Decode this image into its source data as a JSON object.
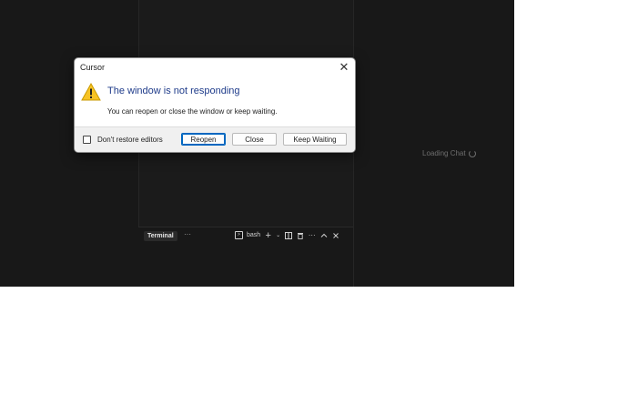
{
  "dialog": {
    "title": "Cursor",
    "heading": "The window is not responding",
    "message": "You can reopen or close the window or keep waiting.",
    "checkbox_label": "Don't restore editors",
    "checkbox_checked": false,
    "buttons": {
      "reopen": "Reopen",
      "close": "Close",
      "keep_waiting": "Keep Waiting"
    },
    "close_icon": "close-icon",
    "warning_icon": "warning-icon"
  },
  "chat": {
    "loading": "Loading Chat"
  },
  "terminal": {
    "tab_label": "Terminal",
    "more": "···",
    "shell": "bash",
    "icons": [
      "terminal-icon",
      "plus-icon",
      "chevron-down-icon",
      "split-icon",
      "trash-icon",
      "more-icon",
      "chevron-up-icon",
      "close-icon"
    ]
  },
  "colors": {
    "app_bg": "#181818",
    "heading": "#1e3b8a",
    "primary_border": "#0067c0"
  }
}
